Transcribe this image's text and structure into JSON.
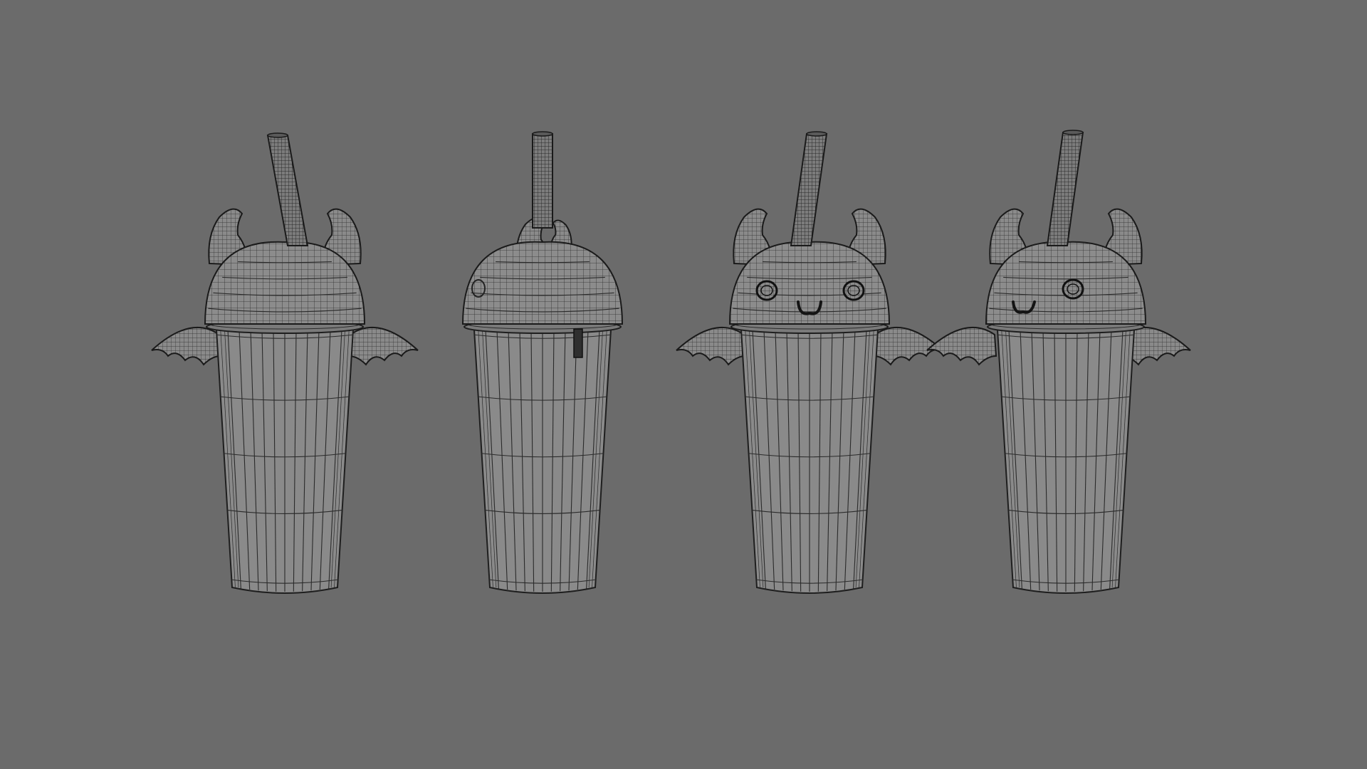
{
  "scene": {
    "background_color": "#6b6b6b",
    "surface_color": "#8a8a8a",
    "wire_color": "#2a2a2a",
    "models": [
      {
        "view": "front-left",
        "has_wings": true,
        "has_face": false,
        "eye_count": 0
      },
      {
        "view": "side",
        "has_wings": false,
        "has_face": false,
        "eye_count": 0
      },
      {
        "view": "front",
        "has_wings": true,
        "has_face": true,
        "eye_count": 2
      },
      {
        "view": "three-quarter",
        "has_wings": true,
        "has_face": true,
        "eye_count": 1
      }
    ]
  }
}
